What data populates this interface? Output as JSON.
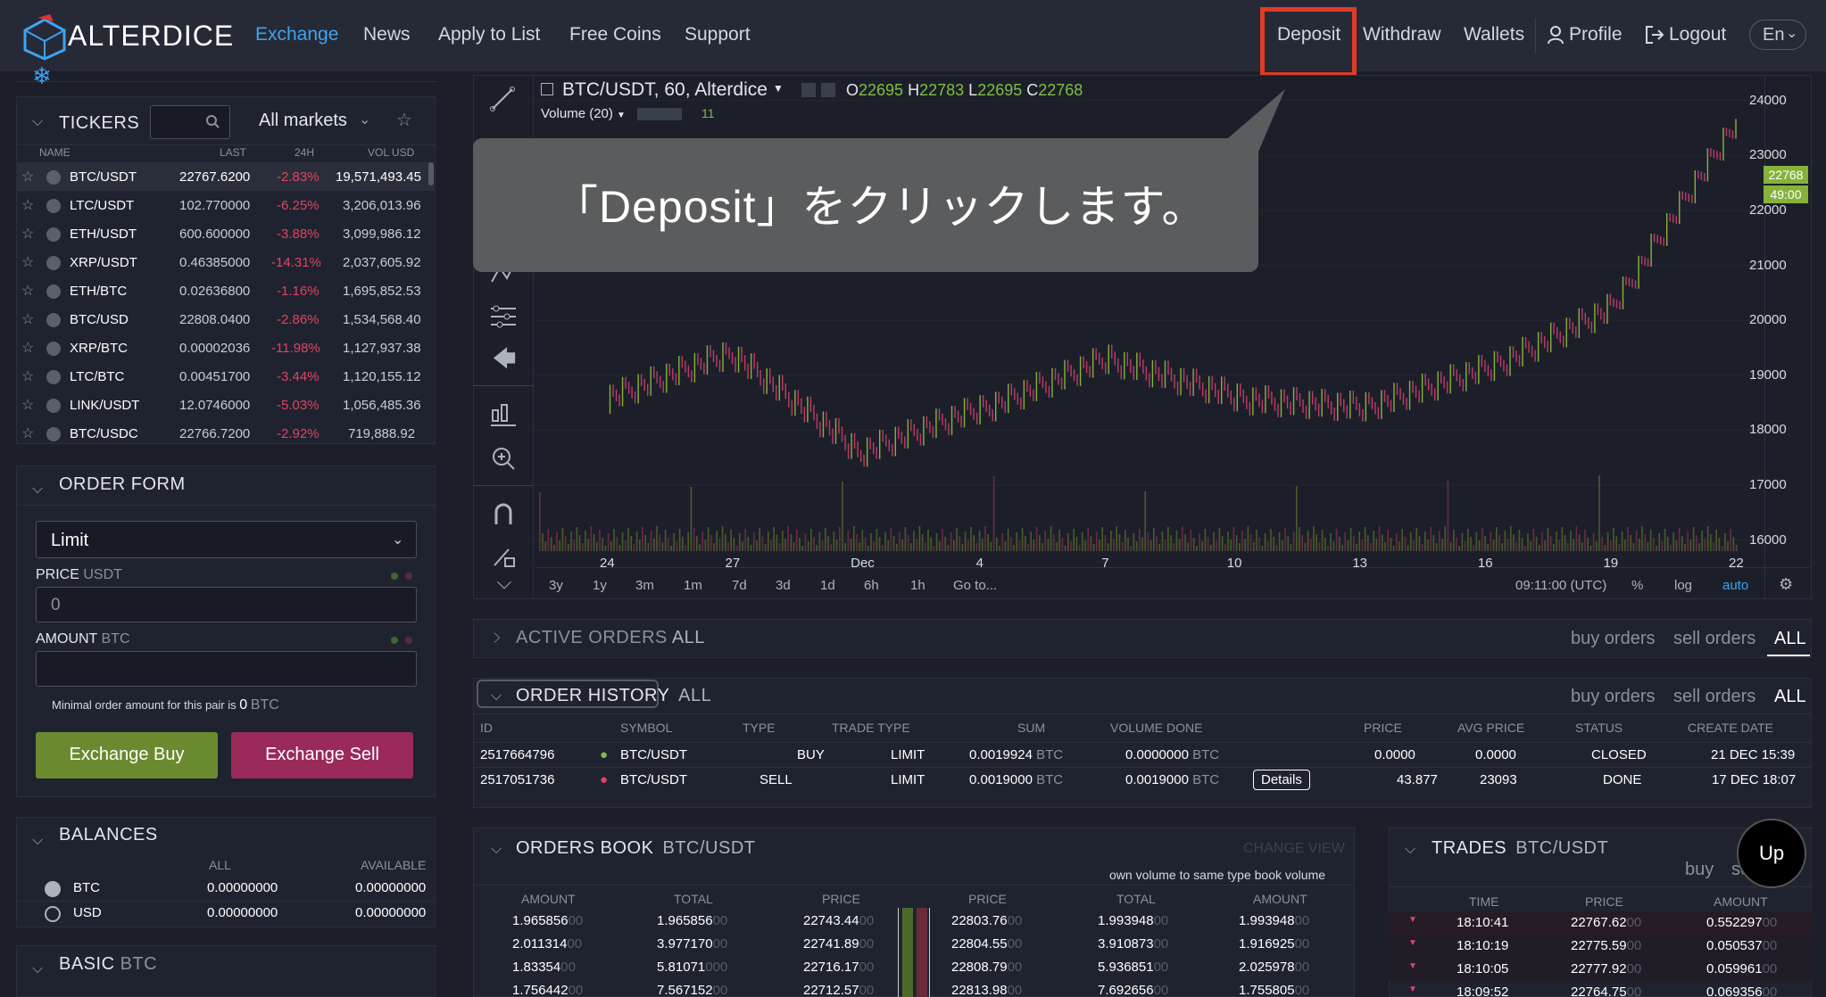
{
  "header": {
    "logo_text": "ALTERDICE",
    "nav": [
      "Exchange",
      "News",
      "Apply to List",
      "Free Coins",
      "Support"
    ],
    "right_nav": [
      "Deposit",
      "Withdraw",
      "Wallets",
      "Profile",
      "Logout"
    ],
    "lang": "En"
  },
  "tooltip": "「Deposit」をクリックします。",
  "tickers": {
    "title": "TICKERS",
    "markets": "All markets",
    "headers": [
      "NAME",
      "LAST",
      "24H",
      "VOL USD"
    ],
    "rows": [
      {
        "name": "BTC/USDT",
        "last": "22767.6200",
        "change": "-2.83%",
        "vol": "19,571,493.45"
      },
      {
        "name": "LTC/USDT",
        "last": "102.770000",
        "change": "-6.25%",
        "vol": "3,206,013.96"
      },
      {
        "name": "ETH/USDT",
        "last": "600.600000",
        "change": "-3.88%",
        "vol": "3,099,986.12"
      },
      {
        "name": "XRP/USDT",
        "last": "0.46385000",
        "change": "-14.31%",
        "vol": "2,037,605.92"
      },
      {
        "name": "ETH/BTC",
        "last": "0.02636800",
        "change": "-1.16%",
        "vol": "1,695,852.53"
      },
      {
        "name": "BTC/USD",
        "last": "22808.0400",
        "change": "-2.86%",
        "vol": "1,534,568.40"
      },
      {
        "name": "XRP/BTC",
        "last": "0.00002036",
        "change": "-11.98%",
        "vol": "1,127,937.38"
      },
      {
        "name": "LTC/BTC",
        "last": "0.00451700",
        "change": "-3.44%",
        "vol": "1,120,155.12"
      },
      {
        "name": "LINK/USDT",
        "last": "12.0746000",
        "change": "-5.03%",
        "vol": "1,056,485.36"
      },
      {
        "name": "BTC/USDC",
        "last": "22766.7200",
        "change": "-2.92%",
        "vol": "719,888.92"
      }
    ]
  },
  "order_form": {
    "title": "ORDER FORM",
    "type": "Limit",
    "price_label": "PRICE",
    "price_unit": "USDT",
    "price_value": "0",
    "amount_label": "AMOUNT",
    "amount_unit": "BTC",
    "min_text": "Minimal order amount for this pair is",
    "min_value": "0",
    "min_unit": "BTC",
    "buy": "Exchange Buy",
    "sell": "Exchange Sell"
  },
  "balances": {
    "title": "BALANCES",
    "headers": [
      "ALL",
      "AVAILABLE"
    ],
    "rows": [
      {
        "coin": "BTC",
        "all": "0.00000000",
        "available": "0.00000000"
      },
      {
        "coin": "USD",
        "all": "0.00000000",
        "available": "0.00000000"
      }
    ]
  },
  "basic": {
    "title": "BASIC",
    "pair": "BTC"
  },
  "chart": {
    "symbol": "BTC/USDT, 60, Alterdice",
    "o_label": "O",
    "o": "22695",
    "h_label": "H",
    "h": "22783",
    "l_label": "L",
    "l": "22695",
    "c_label": "C",
    "c": "22768",
    "volume_label": "Volume (20)",
    "volume_value": "11",
    "price_tag": "22768",
    "time_tag": "49:00",
    "timeframes": [
      "3y",
      "1y",
      "3m",
      "1m",
      "7d",
      "3d",
      "1d",
      "6h",
      "1h",
      "Go to..."
    ],
    "time": "09:11:00 (UTC)",
    "percent": "%",
    "log": "log",
    "auto": "auto"
  },
  "chart_data": {
    "type": "line",
    "x": [
      "24",
      "27",
      "Dec",
      "4",
      "7",
      "10",
      "13",
      "16",
      "19",
      "22"
    ],
    "y_ticks": [
      16000,
      17000,
      18000,
      19000,
      20000,
      21000,
      22000,
      23000,
      24000
    ],
    "ylim": [
      15800,
      24400
    ],
    "series": [
      {
        "values": [
          18600,
          19400,
          17600,
          18400,
          19300,
          18600,
          18400,
          19100,
          20200,
          23600
        ]
      }
    ]
  },
  "active_orders": {
    "title": "ACTIVE ORDERS",
    "all": "ALL",
    "tabs": [
      "buy orders",
      "sell orders",
      "ALL"
    ]
  },
  "order_history": {
    "title": "ORDER HISTORY",
    "all": "ALL",
    "tabs": [
      "buy orders",
      "sell orders",
      "ALL"
    ],
    "headers": [
      "ID",
      "SYMBOL",
      "TYPE",
      "TRADE TYPE",
      "SUM",
      "VOLUME DONE",
      "PRICE",
      "AVG PRICE",
      "STATUS",
      "CREATE DATE"
    ],
    "details": "Details",
    "rows": [
      {
        "id": "2517664796",
        "symbol": "BTC/USDT",
        "type": "BUY",
        "trade": "LIMIT",
        "sum": "0.0019924",
        "sum_unit": "BTC",
        "vol": "0.0000000",
        "vol_unit": "BTC",
        "price": "0.0000",
        "avg": "0.0000",
        "status": "CLOSED",
        "date": "21 DEC 15:39"
      },
      {
        "id": "2517051736",
        "symbol": "BTC/USDT",
        "type": "SELL",
        "trade": "LIMIT",
        "sum": "0.0019000",
        "sum_unit": "BTC",
        "vol": "0.0019000",
        "vol_unit": "BTC",
        "price": "43.877",
        "avg": "23093",
        "status": "DONE",
        "date": "17 DEC 18:07"
      }
    ]
  },
  "orders_book": {
    "title": "ORDERS BOOK",
    "pair": "BTC/USDT",
    "change_view": "CHANGE VIEW",
    "note": "own volume to same type book volume",
    "headers": [
      "AMOUNT",
      "TOTAL",
      "PRICE",
      "PRICE",
      "TOTAL",
      "AMOUNT"
    ],
    "rows": [
      [
        "1.965856",
        "00",
        "1.965856",
        "00",
        "22743.44",
        "00",
        "22803.76",
        "00",
        "1.993948",
        "00",
        "1.993948",
        "00"
      ],
      [
        "2.011314",
        "00",
        "3.977170",
        "00",
        "22741.89",
        "00",
        "22804.55",
        "00",
        "3.910873",
        "00",
        "1.916925",
        "00"
      ],
      [
        "1.83354",
        "00",
        "5.81071",
        "000",
        "22716.17",
        "00",
        "22808.79",
        "00",
        "5.936851",
        "00",
        "2.025978",
        "00"
      ],
      [
        "1.756442",
        "00",
        "7.567152",
        "00",
        "22712.57",
        "00",
        "22813.98",
        "00",
        "7.692656",
        "00",
        "1.755805",
        "00"
      ]
    ]
  },
  "trades": {
    "title": "TRADES",
    "pair": "BTC/USDT",
    "buy": "buy",
    "sell": "se",
    "headers": [
      "TIME",
      "PRICE",
      "AMOUNT"
    ],
    "rows": [
      [
        "18:10:41",
        "22767.62",
        "00",
        "0.552297",
        "00"
      ],
      [
        "18:10:19",
        "22775.59",
        "00",
        "0.050537",
        "00"
      ],
      [
        "18:10:05",
        "22777.92",
        "00",
        "0.059961",
        "00"
      ],
      [
        "18:09:52",
        "22764.75",
        "00",
        "0.069356",
        "00"
      ]
    ]
  },
  "up_button": "Up"
}
